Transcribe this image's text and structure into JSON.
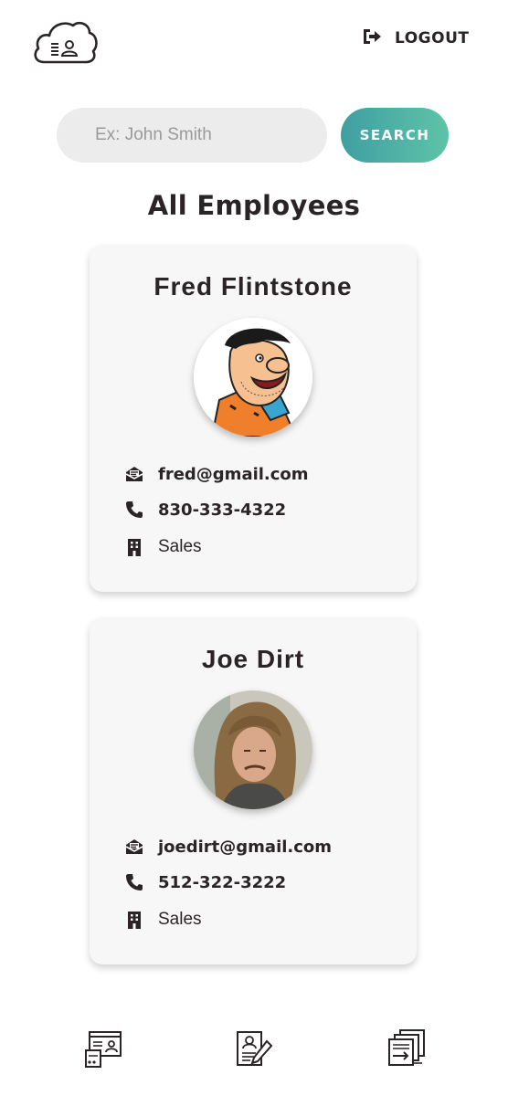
{
  "header": {
    "logo_icon": "cloud-employee-icon",
    "logout_icon": "sign-out-icon",
    "logout_label": "LOGOUT"
  },
  "search": {
    "placeholder": "Ex: John Smith",
    "value": "",
    "button_label": "SEARCH",
    "button_gradient": [
      "#3f9fa2",
      "#5ec3a8"
    ]
  },
  "page_title": "All Employees",
  "employees": [
    {
      "name": "Fred Flintstone",
      "email": "fred@gmail.com",
      "phone": "830-333-4322",
      "department": "Sales"
    },
    {
      "name": "Joe Dirt",
      "email": "joedirt@gmail.com",
      "phone": "512-322-3222",
      "department": "Sales"
    }
  ],
  "icons": {
    "email": "envelope-open-icon",
    "phone": "phone-icon",
    "department": "building-icon"
  },
  "bottom_nav": [
    {
      "icon": "employee-directory-icon"
    },
    {
      "icon": "employee-profile-edit-icon"
    },
    {
      "icon": "records-transfer-icon"
    }
  ],
  "colors": {
    "text": "#2b2426",
    "card_bg": "#f7f7f7",
    "input_bg": "#ececec"
  }
}
